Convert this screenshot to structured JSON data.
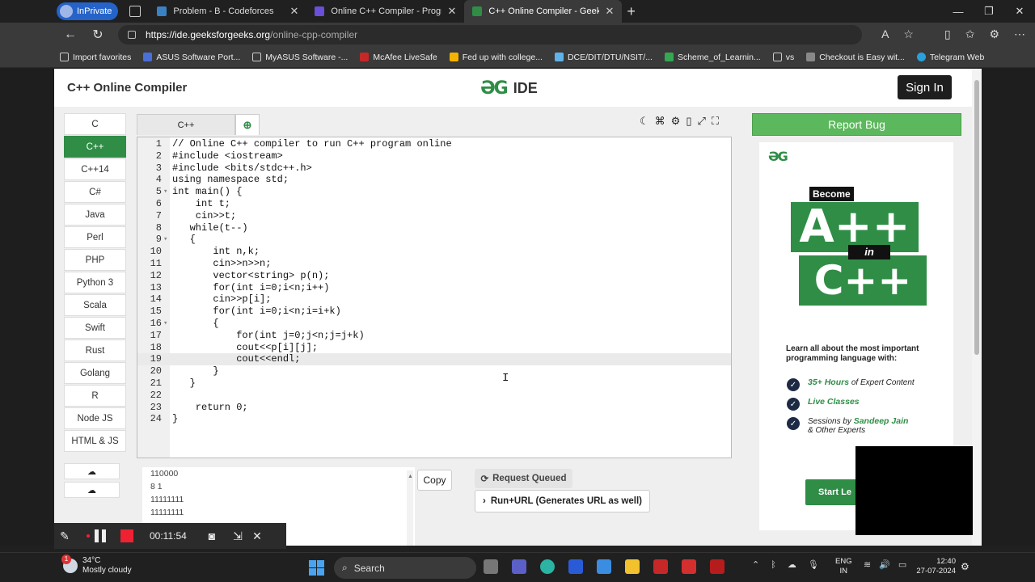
{
  "browser": {
    "inprivate_label": "InPrivate",
    "tabs": [
      {
        "title": "Problem - B - Codeforces",
        "active": false
      },
      {
        "title": "Online C++ Compiler - Programi",
        "active": false
      },
      {
        "title": "C++ Online Compiler - Geeksfor",
        "active": true
      }
    ],
    "url_host": "https://ide.geeksforgeeks.org",
    "url_path": "/online-cpp-compiler",
    "favorites": [
      "Import favorites",
      "ASUS Software Port...",
      "MyASUS Software -...",
      "McAfee LiveSafe",
      "Fed up with college...",
      "DCE/DIT/DTU/NSIT/...",
      "Scheme_of_Learnin...",
      "vs",
      "Checkout is Easy wit...",
      "Telegram Web"
    ]
  },
  "header": {
    "title": "C++ Online Compiler",
    "logo_text": "IDE",
    "signin_label": "Sign In"
  },
  "languages": [
    "C",
    "C++",
    "C++14",
    "C#",
    "Java",
    "Perl",
    "PHP",
    "Python 3",
    "Scala",
    "Swift",
    "Rust",
    "Golang",
    "R",
    "Node JS",
    "HTML & JS"
  ],
  "active_language": "C++",
  "editor": {
    "tab_label": "C++",
    "lines": [
      "// Online C++ compiler to run C++ program online",
      "#include <iostream>",
      "#include <bits/stdc++.h>",
      "using namespace std;",
      "int main() {",
      "    int t;",
      "    cin>>t;",
      "   while(t--)",
      "   {",
      "       int n,k;",
      "       cin>>n>>n;",
      "       vector<string> p(n);",
      "       for(int i=0;i<n;i++)",
      "       cin>>p[i];",
      "       for(int i=0;i<n;i=i+k)",
      "       {",
      "           for(int j=0;j<n;j=j+k)",
      "           cout<<p[i][j];",
      "           cout<<endl;",
      "       }",
      "   }",
      "",
      "    return 0;",
      "}"
    ],
    "fold_lines": [
      5,
      9,
      16
    ],
    "current_line": 19
  },
  "output": {
    "lines": [
      "110000",
      "8 1",
      "11111111",
      "11111111"
    ],
    "copy_label": "Copy",
    "status_label": "Request Queued",
    "run_url_label": "Run+URL (Generates URL as well)"
  },
  "sidebar": {
    "report_bug_label": "Report Bug"
  },
  "ad": {
    "become": "Become",
    "big1": "A++",
    "in": "in",
    "big2": "C++",
    "learn": "Learn all about the most important programming language with:",
    "features": [
      {
        "highlight": "35+ Hours",
        "rest": " of Expert Content"
      },
      {
        "highlight": "Live Classes",
        "rest": ""
      },
      {
        "highlight": "Sandeep Jain",
        "prefix": "Sessions by ",
        "rest": "& Other Experts"
      }
    ],
    "cta": "Start Le"
  },
  "recorder": {
    "time": "00:11:54"
  },
  "taskbar": {
    "temperature": "34°C",
    "weather": "Mostly cloudy",
    "weather_badge": "1",
    "search_label": "Search",
    "lang1": "ENG",
    "lang2": "IN",
    "time": "12:40",
    "date": "27-07-2024"
  }
}
